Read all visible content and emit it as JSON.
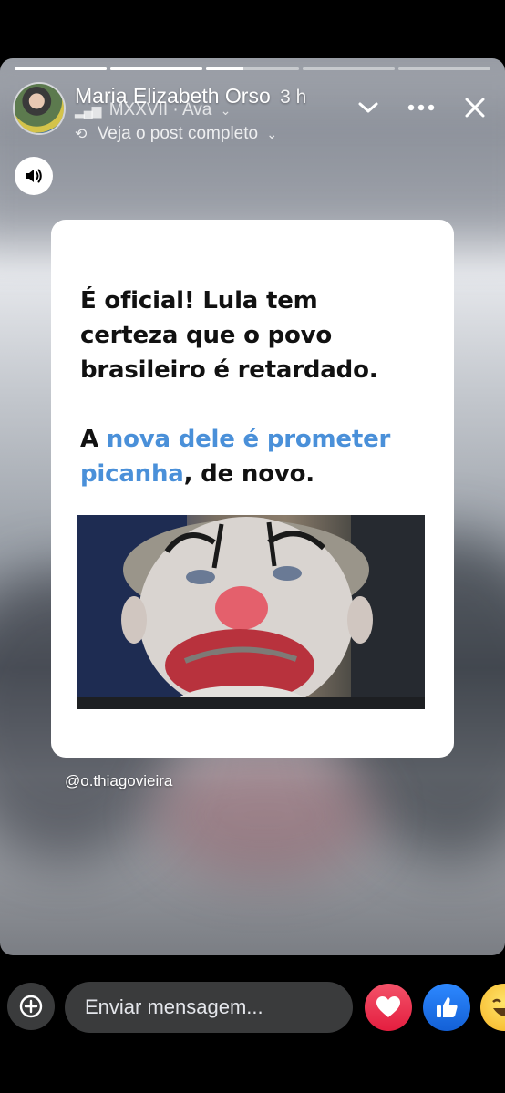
{
  "story": {
    "progress": [
      1,
      1,
      0.4,
      0,
      0
    ],
    "author": "Maria Elizabeth Orso",
    "time": "3 h",
    "music": "MXXVII · Ava",
    "see_post": "Veja o post completo"
  },
  "post": {
    "line1": "É oficial! Lula tem",
    "line2": "certeza que o povo",
    "line3": "brasileiro é retardado.",
    "line4_a": "A ",
    "line4_b": "nova dele é prometer",
    "line5_a": "picanha",
    "line5_b": ", de novo.",
    "handle": "@o.thiagovieira"
  },
  "composer": {
    "placeholder": "Enviar mensagem..."
  },
  "colors": {
    "accent_blue": "#4a90d9",
    "love": "#f0284a",
    "like": "#1877f2"
  }
}
